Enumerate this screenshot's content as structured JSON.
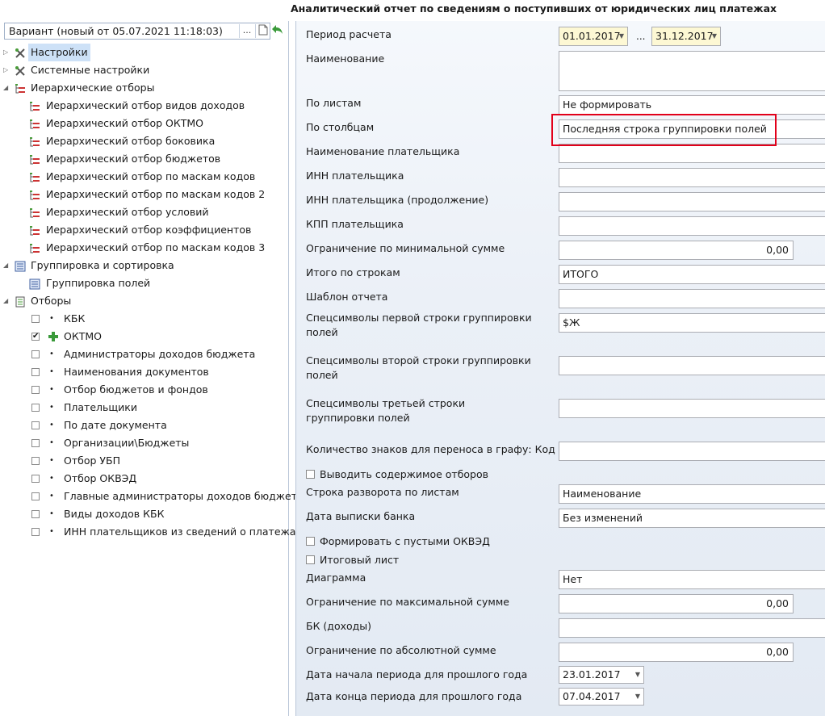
{
  "window": {
    "title": "Аналитический отчет по сведениям о поступивших от юридических лиц платежах"
  },
  "variant": {
    "value": "Вариант (новый от 05.07.2021 11:18:03)",
    "dots_label": "...",
    "back_icon": "undo-arrow-icon"
  },
  "tree": [
    {
      "label": "Настройки",
      "level": 0,
      "icon": "settings-tools-icon",
      "expander": "▷",
      "selected": true
    },
    {
      "label": "Системные настройки",
      "level": 0,
      "icon": "settings-tools-icon",
      "expander": "▷"
    },
    {
      "label": "Иерархические отборы",
      "level": 0,
      "icon": "hierarchy-icon",
      "expander": "◢"
    },
    {
      "label": "Иерархический отбор видов доходов",
      "level": 1,
      "icon": "hierarchy-icon"
    },
    {
      "label": "Иерархический отбор ОКТМО",
      "level": 1,
      "icon": "hierarchy-icon"
    },
    {
      "label": "Иерархический отбор боковика",
      "level": 1,
      "icon": "hierarchy-icon"
    },
    {
      "label": "Иерархический отбор бюджетов",
      "level": 1,
      "icon": "hierarchy-icon"
    },
    {
      "label": "Иерархический отбор по маскам кодов",
      "level": 1,
      "icon": "hierarchy-icon"
    },
    {
      "label": "Иерархический отбор по маскам кодов 2",
      "level": 1,
      "icon": "hierarchy-icon"
    },
    {
      "label": "Иерархический отбор условий",
      "level": 1,
      "icon": "hierarchy-icon"
    },
    {
      "label": "Иерархический отбор коэффициентов",
      "level": 1,
      "icon": "hierarchy-icon"
    },
    {
      "label": "Иерархический отбор по маскам кодов 3",
      "level": 1,
      "icon": "hierarchy-icon"
    },
    {
      "label": "Группировка и сортировка",
      "level": 0,
      "icon": "grouping-icon",
      "expander": "◢"
    },
    {
      "label": "Группировка полей",
      "level": 1,
      "icon": "grouping-icon"
    },
    {
      "label": "Отборы",
      "level": 0,
      "icon": "filter-list-icon",
      "expander": "◢"
    },
    {
      "label": "КБК",
      "level": 1,
      "checkbox": true,
      "checked": false,
      "marker": "bullet"
    },
    {
      "label": "ОКТМО",
      "level": 1,
      "checkbox": true,
      "checked": true,
      "marker": "plus"
    },
    {
      "label": "Администраторы доходов бюджета",
      "level": 1,
      "checkbox": true,
      "checked": false,
      "marker": "bullet"
    },
    {
      "label": "Наименования документов",
      "level": 1,
      "checkbox": true,
      "checked": false,
      "marker": "bullet"
    },
    {
      "label": "Отбор бюджетов и фондов",
      "level": 1,
      "checkbox": true,
      "checked": false,
      "marker": "bullet"
    },
    {
      "label": "Плательщики",
      "level": 1,
      "checkbox": true,
      "checked": false,
      "marker": "bullet"
    },
    {
      "label": "По дате документа",
      "level": 1,
      "checkbox": true,
      "checked": false,
      "marker": "bullet"
    },
    {
      "label": "Организации\\Бюджеты",
      "level": 1,
      "checkbox": true,
      "checked": false,
      "marker": "bullet"
    },
    {
      "label": "Отбор УБП",
      "level": 1,
      "checkbox": true,
      "checked": false,
      "marker": "bullet"
    },
    {
      "label": "Отбор ОКВЭД",
      "level": 1,
      "checkbox": true,
      "checked": false,
      "marker": "bullet"
    },
    {
      "label": "Главные администраторы доходов бюджет",
      "level": 1,
      "checkbox": true,
      "checked": false,
      "marker": "bullet"
    },
    {
      "label": "Виды доходов КБК",
      "level": 1,
      "checkbox": true,
      "checked": false,
      "marker": "bullet"
    },
    {
      "label": "ИНН плательщиков из сведений о платежа",
      "level": 1,
      "checkbox": true,
      "checked": false,
      "marker": "bullet"
    }
  ],
  "form": {
    "period_label": "Период расчета",
    "period_from": "01.01.2017",
    "period_sep": "...",
    "period_to": "31.12.2017",
    "name_label": "Наименование",
    "by_sheets_label": "По листам",
    "by_sheets_value": "Не формировать",
    "by_columns_label": "По столбцам",
    "by_columns_value": "Последняя строка группировки полей",
    "payer_name_label": "Наименование плательщика",
    "payer_inn_label": "ИНН плательщика",
    "payer_inn_cont_label": "ИНН плательщика (продолжение)",
    "payer_kpp_label": "КПП плательщика",
    "min_sum_label": "Ограничение по минимальной сумме",
    "min_sum_value": "0,00",
    "rows_total_label": "Итого по строкам",
    "rows_total_value": "ИТОГО",
    "template_label": "Шаблон отчета",
    "spec1_label": "Спецсимволы первой строки группировки полей",
    "spec1_value": "$Ж",
    "spec2_label": "Спецсимволы второй строки группировки полей",
    "spec3_label": "Спецсимволы третьей строки группировки полей",
    "chars_label": "Количество знаков для переноса в графу: Код",
    "show_filters_label": "Выводить содержимое отборов",
    "sheet_row_label": "Строка разворота по листам",
    "sheet_row_value": "Наименование",
    "bank_date_label": "Дата выписки банка",
    "bank_date_value": "Без изменений",
    "empty_okved_label": "Формировать с пустыми ОКВЭД",
    "total_sheet_label": "Итоговый лист",
    "diagram_label": "Диаграмма",
    "diagram_value": "Нет",
    "max_sum_label": "Ограничение по максимальной сумме",
    "max_sum_value": "0,00",
    "bk_label": "БК (доходы)",
    "abs_sum_label": "Ограничение по абсолютной сумме",
    "abs_sum_value": "0,00",
    "prev_start_label": "Дата начала периода для прошлого года",
    "prev_start_value": "23.01.2017",
    "prev_end_label": "Дата конца периода для прошлого года",
    "prev_end_value": "07.04.2017"
  },
  "colors": {
    "highlight": "#e2001a",
    "date_field_bg": "#fdf8d4",
    "selected_bg": "#cde1f7"
  }
}
